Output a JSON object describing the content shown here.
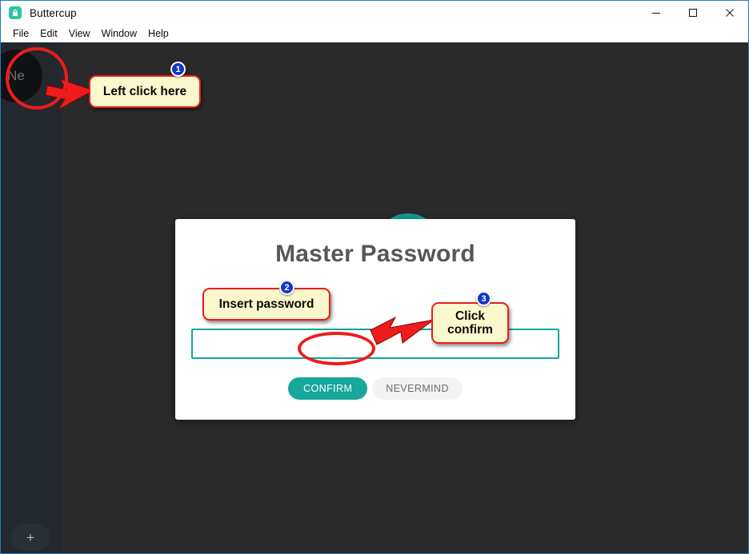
{
  "window": {
    "title": "Buttercup",
    "app_icon": "buttercup-lock-icon",
    "controls": {
      "minimize": "minimize-icon",
      "maximize": "maximize-icon",
      "close": "close-icon"
    }
  },
  "menu": {
    "items": [
      {
        "label": "File"
      },
      {
        "label": "Edit"
      },
      {
        "label": "View"
      },
      {
        "label": "Window"
      },
      {
        "label": "Help"
      }
    ]
  },
  "sidebar": {
    "vault_avatar_label": "Ne",
    "add_vault_label": "+"
  },
  "dialog": {
    "title": "Master Password",
    "password_value": "",
    "password_placeholder": "",
    "confirm_label": "CONFIRM",
    "nevermind_label": "NEVERMIND"
  },
  "annotations": {
    "steps": [
      {
        "number": "1",
        "text": "Left click here"
      },
      {
        "number": "2",
        "text": "Insert password"
      },
      {
        "number": "3",
        "text": "Click confirm"
      }
    ]
  },
  "colors": {
    "accent_teal": "#17a79b",
    "input_border_teal": "#0fa79b",
    "annotation_red": "#ee1c1c",
    "callout_yellow": "#fbf8cd",
    "badge_blue": "#1336c9",
    "window_border_blue": "#1d7dc4",
    "sidebar_dark": "#23282e",
    "main_dark": "#2a2a2a",
    "dialog_title_gray": "#575757"
  }
}
